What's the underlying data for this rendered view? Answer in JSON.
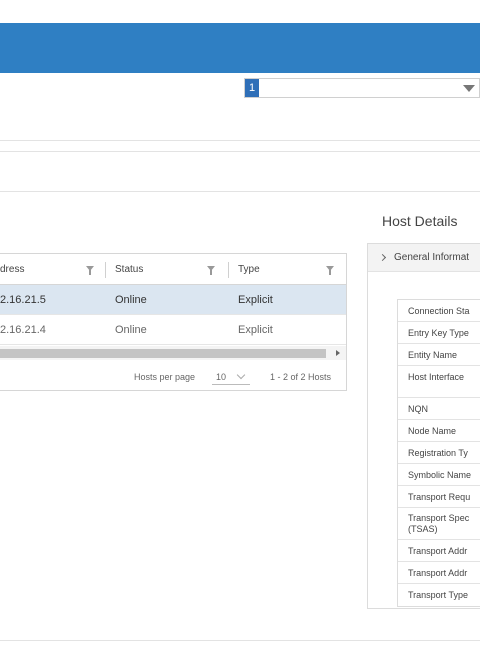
{
  "toolbar": {
    "select_value": "1"
  },
  "grid": {
    "columns": [
      {
        "label": "dress"
      },
      {
        "label": "Status"
      },
      {
        "label": "Type"
      }
    ],
    "rows": [
      {
        "address": "2.16.21.5",
        "status": "Online",
        "type": "Explicit",
        "selected": true
      },
      {
        "address": "2.16.21.4",
        "status": "Online",
        "type": "Explicit",
        "selected": false
      }
    ],
    "footer": {
      "per_page_label": "Hosts per page",
      "per_page_value": "10",
      "pager_info": "1 - 2 of 2 Hosts"
    }
  },
  "details": {
    "title": "Host Details",
    "section_label": "General Informat",
    "properties": [
      {
        "label": "Connection Sta"
      },
      {
        "label": "Entry Key Type"
      },
      {
        "label": "Entity Name"
      },
      {
        "label": "Host Interface"
      },
      {
        "label": "NQN"
      },
      {
        "label": "Node Name"
      },
      {
        "label": "Registration Ty"
      },
      {
        "label": "Symbolic Name"
      },
      {
        "label": "Transport Requ"
      },
      {
        "label": "Transport Spec",
        "label2": "(TSAS)"
      },
      {
        "label": "Transport Addr"
      },
      {
        "label": "Transport Addr"
      },
      {
        "label": "Transport Type"
      }
    ]
  },
  "colors": {
    "header_blue": "#2f7fc3",
    "selected_row": "#dbe6f1"
  }
}
